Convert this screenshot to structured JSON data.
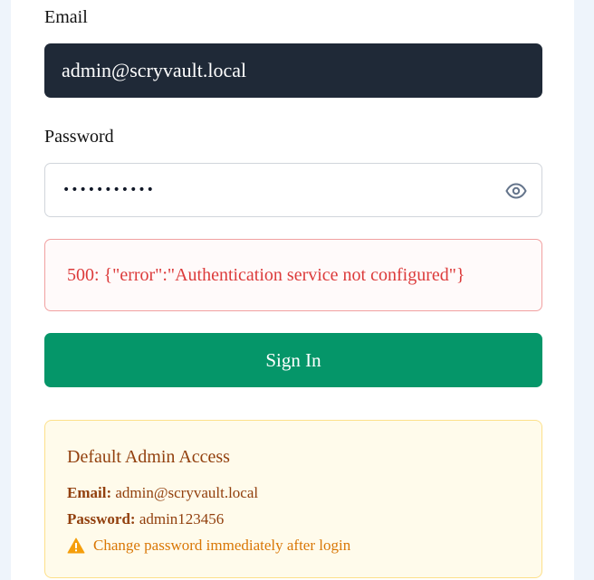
{
  "login": {
    "email_label": "Email",
    "email_value": "admin@scryvault.local",
    "password_label": "Password",
    "password_value": "•••••••••••",
    "error_message": "500: {\"error\":\"Authentication service not configured\"}",
    "submit_label": "Sign In"
  },
  "default_admin": {
    "title": "Default Admin Access",
    "email_label": "Email:",
    "email_value": "admin@scryvault.local",
    "password_label": "Password:",
    "password_value": "admin123456",
    "warning": "Change password immediately after login"
  },
  "icons": {
    "password_toggle": "eye-icon",
    "warning": "warning-icon"
  },
  "colors": {
    "primary_button": "#059669",
    "input_dark": "#1f2937",
    "error": "#dc3b3b",
    "notice_bg": "#fffbeb",
    "notice_text": "#92400e",
    "warning": "#d97706"
  }
}
